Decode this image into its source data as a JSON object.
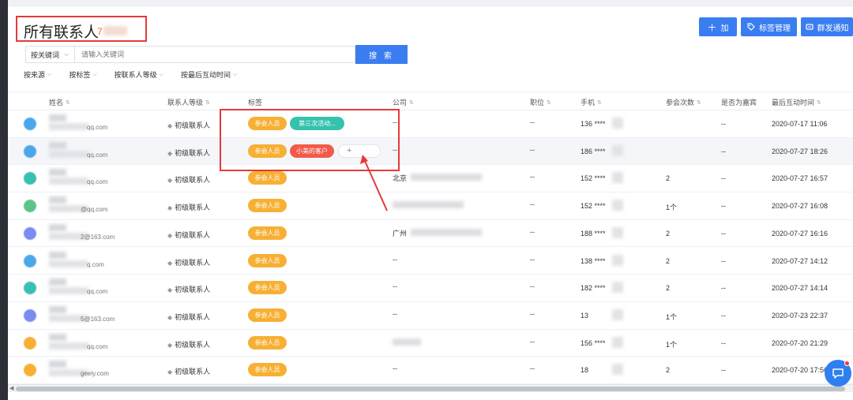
{
  "header": {
    "title": "所有联系人",
    "count_prefix": "7",
    "buttons": {
      "add_icon": "＋",
      "add": "加",
      "tag_manage_icon": "tag-icon",
      "tag_manage": "标签管理",
      "mass_notify_icon": "message-icon",
      "mass_notify": "群发通知"
    }
  },
  "search": {
    "select_value": "按关键词",
    "placeholder": "请输入关键词",
    "button": "搜 索"
  },
  "filters": [
    "按来源",
    "按标签",
    "按联系人等级",
    "按最后互动时间"
  ],
  "columns": {
    "name": "姓名",
    "level": "联系人等级",
    "tags": "标签",
    "company": "公司",
    "position": "职位",
    "phone": "手机",
    "attend_count": "参会次数",
    "is_guest": "是否为嘉宾",
    "last_interaction": "最后互动时间"
  },
  "rows": [
    {
      "email": "qq.com",
      "level": "初级联系人",
      "tags": [
        "参会人员",
        "第三次活动..."
      ],
      "company": "--",
      "position": "--",
      "phone": "136 ****",
      "count": "",
      "guest": "--",
      "time": "2020-07-17 11:06"
    },
    {
      "email": "qq.com",
      "level": "初级联系人",
      "tags": [
        "参会人员",
        "小美的客户"
      ],
      "company": "--",
      "position": "--",
      "phone": "186 ****",
      "count": "",
      "guest": "--",
      "time": "2020-07-27 18:26"
    },
    {
      "email": "qq.com",
      "level": "初级联系人",
      "tags": [
        "参会人员"
      ],
      "company": "北京",
      "position": "--",
      "phone": "152 ****",
      "count": "2",
      "guest": "--",
      "time": "2020-07-27 16:57"
    },
    {
      "email": "@qq.com",
      "level": "初级联系人",
      "tags": [
        "参会人员"
      ],
      "company": "",
      "position": "--",
      "phone": "152 ****",
      "count": "1个",
      "guest": "--",
      "time": "2020-07-27 16:08"
    },
    {
      "email": "2@163.com",
      "level": "初级联系人",
      "tags": [
        "参会人员"
      ],
      "company": "广州",
      "position": "--",
      "phone": "188 ****",
      "count": "2",
      "guest": "--",
      "time": "2020-07-27 16:16"
    },
    {
      "email": "q.com",
      "level": "初级联系人",
      "tags": [
        "参会人员"
      ],
      "company": "--",
      "position": "--",
      "phone": "138 ****",
      "count": "2",
      "guest": "--",
      "time": "2020-07-27 14:12"
    },
    {
      "email": "qq.com",
      "level": "初级联系人",
      "tags": [
        "参会人员"
      ],
      "company": "--",
      "position": "--",
      "phone": "182 ****",
      "count": "2",
      "guest": "--",
      "time": "2020-07-27 14:14"
    },
    {
      "email": "5@163.com",
      "level": "初级联系人",
      "tags": [
        "参会人员"
      ],
      "company": "--",
      "position": "--",
      "phone": "13",
      "count": "1个",
      "guest": "--",
      "time": "2020-07-23 22:37"
    },
    {
      "email": "qq.com",
      "level": "初级联系人",
      "tags": [
        "参会人员"
      ],
      "company": "",
      "position": "--",
      "phone": "156 ****",
      "count": "1个",
      "guest": "--",
      "time": "2020-07-20 21:29"
    },
    {
      "email": "geely.com",
      "level": "初级联系人",
      "tags": [
        "参会人员"
      ],
      "company": "--",
      "position": "--",
      "phone": "18",
      "count": "2",
      "guest": "--",
      "time": "2020-07-20 17:56"
    }
  ],
  "avatar_colors": [
    "#4aa8ea",
    "#4aa8ea",
    "#38c0b0",
    "#5cc48a",
    "#7a8cf0",
    "#4aa8ea",
    "#38c0b0",
    "#7a8cf0",
    "#f7b034",
    "#f7b034"
  ],
  "tag_add_icon": "+",
  "chat_icon": "chat-bubble-icon",
  "colors": {
    "primary": "#3a7df0",
    "tag_orange": "#f7b034",
    "tag_teal": "#35c2ad",
    "tag_red": "#f25a4a",
    "highlight_red": "#e53a3a"
  }
}
